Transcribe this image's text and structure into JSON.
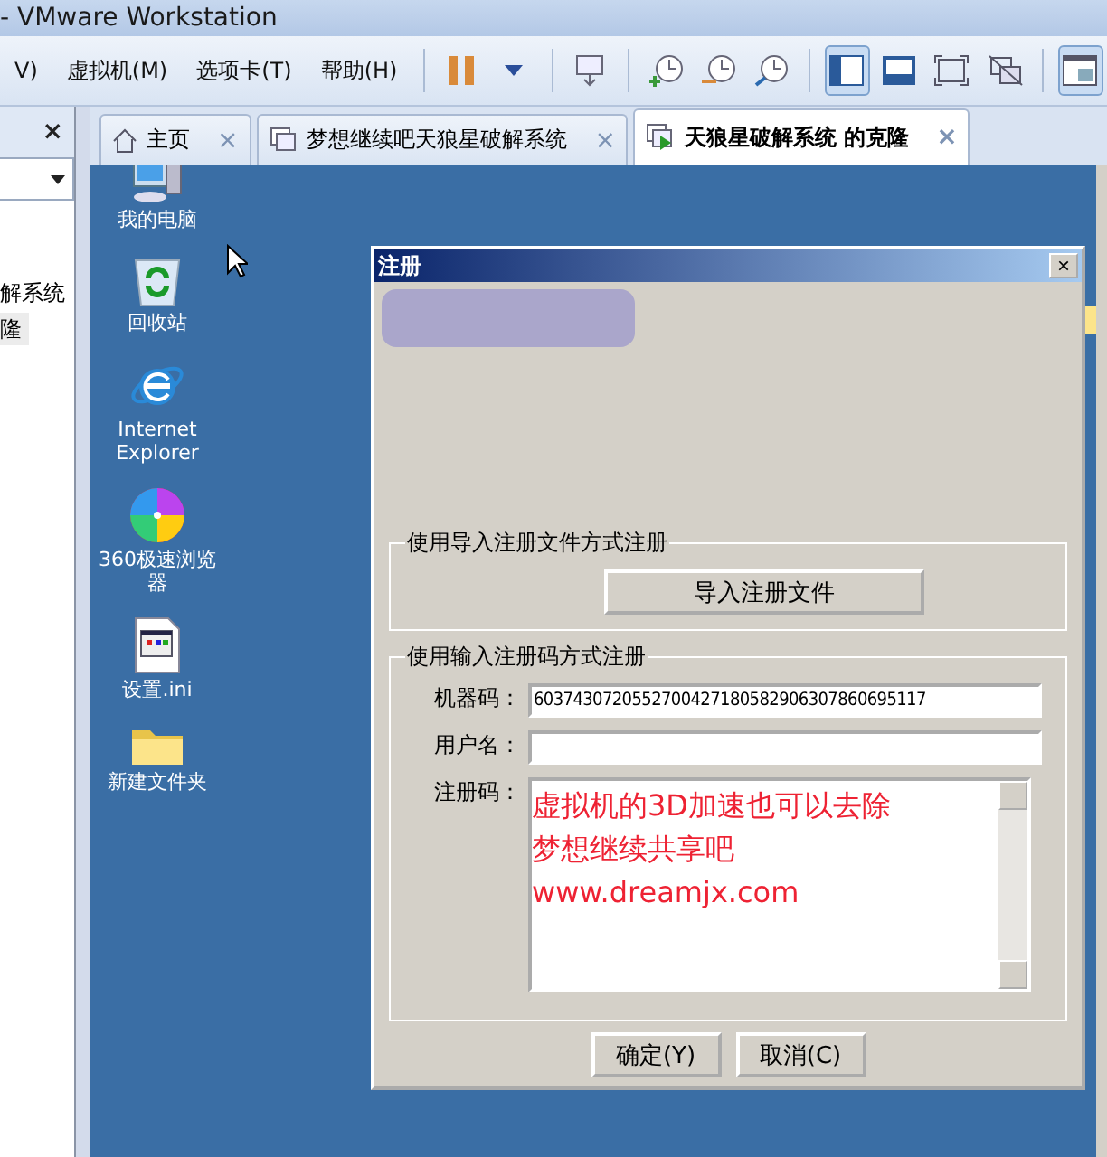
{
  "window": {
    "title": "- VMware Workstation"
  },
  "menu": [
    "V)",
    "虚拟机(M)",
    "选项卡(T)",
    "帮助(H)"
  ],
  "toolbar": [
    [
      {
        "kind": "pause",
        "selected": false
      },
      {
        "kind": "caret",
        "selected": false
      }
    ],
    [
      {
        "kind": "network",
        "selected": false
      }
    ],
    [
      {
        "kind": "clock-plus",
        "selected": false
      },
      {
        "kind": "clock-back",
        "selected": false
      },
      {
        "kind": "clock-wrench",
        "selected": false
      }
    ],
    [
      {
        "kind": "sidebar",
        "selected": true
      },
      {
        "kind": "console",
        "selected": false
      },
      {
        "kind": "fullscreen",
        "selected": false
      },
      {
        "kind": "unity",
        "selected": false
      }
    ],
    [
      {
        "kind": "thumbnail",
        "selected": true
      }
    ]
  ],
  "left_panel": {
    "close": "×",
    "items": [
      {
        "label": "解系统",
        "selected": false
      },
      {
        "label": "隆",
        "selected": true
      }
    ]
  },
  "tabs": [
    {
      "label": "主页",
      "kind": "home",
      "selected": false,
      "close": "×"
    },
    {
      "label": "梦想继续吧天狼星破解系统",
      "kind": "vm",
      "selected": false,
      "close": "×"
    },
    {
      "label": "天狼星破解系统 的克隆",
      "kind": "vm-running",
      "selected": true,
      "close": "×"
    }
  ],
  "desktop_icons": [
    {
      "label": "我的电脑",
      "kind": "computer"
    },
    {
      "label": "回收站",
      "kind": "recycle"
    },
    {
      "label": "Internet Explorer",
      "kind": "ie"
    },
    {
      "label": "360极速浏览器",
      "kind": "browser360"
    },
    {
      "label": "设置.ini",
      "kind": "ini"
    },
    {
      "label": "新建文件夹",
      "kind": "folder"
    }
  ],
  "dialog": {
    "title": "注册",
    "close": "×",
    "import_group": {
      "legend": "使用导入注册文件方式注册",
      "button": "导入注册文件"
    },
    "code_group": {
      "legend": "使用输入注册码方式注册",
      "fields": [
        {
          "label": "机器码：",
          "value": "6037430720552700427180582906307860695117"
        },
        {
          "label": "用户名："
        }
      ],
      "code": {
        "label": "注册码：",
        "lines": [
          "虚拟机的3D加速也可以去除",
          "梦想继续共享吧",
          "www.dreamjx.com"
        ]
      }
    },
    "buttons": [
      "确定(Y)",
      "取消(C)"
    ]
  }
}
